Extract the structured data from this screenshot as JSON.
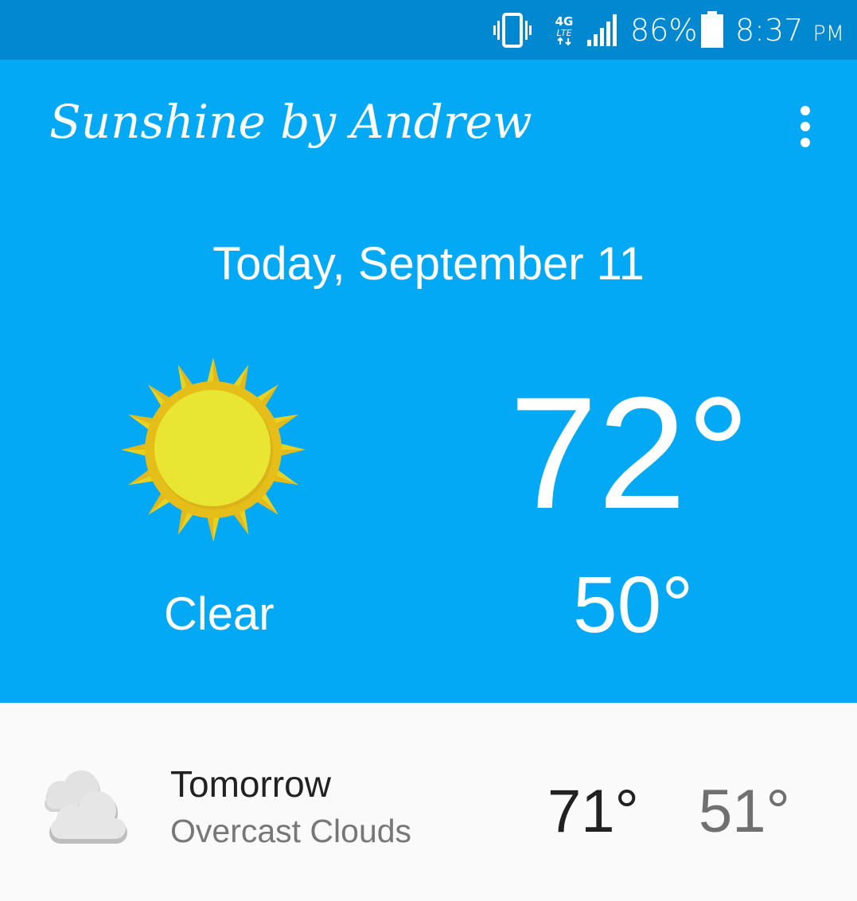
{
  "status_bar": {
    "battery_percent": "86%",
    "time": "8:37",
    "ampm": "PM",
    "network_badge_top": "4G",
    "network_badge_bottom": "LTE",
    "icons": [
      "vibrate-icon",
      "lte-icon",
      "signal-icon",
      "battery-icon"
    ]
  },
  "app_bar": {
    "title": "Sunshine by Andrew",
    "menu_icon": "more-vert-icon"
  },
  "today": {
    "date": "Today, September 11",
    "high": "72°",
    "low": "50°",
    "condition": "Clear",
    "icon": "sun-icon"
  },
  "forecast": [
    {
      "day": "Tomorrow",
      "description": "Overcast Clouds",
      "high": "71°",
      "low": "51°",
      "icon": "cloud-icon"
    }
  ],
  "colors": {
    "status_bar": "#0288d1",
    "primary": "#03a9f4",
    "list_background": "#fafafa",
    "sun_outer": "#e8c217",
    "sun_inner": "#e8e633"
  }
}
